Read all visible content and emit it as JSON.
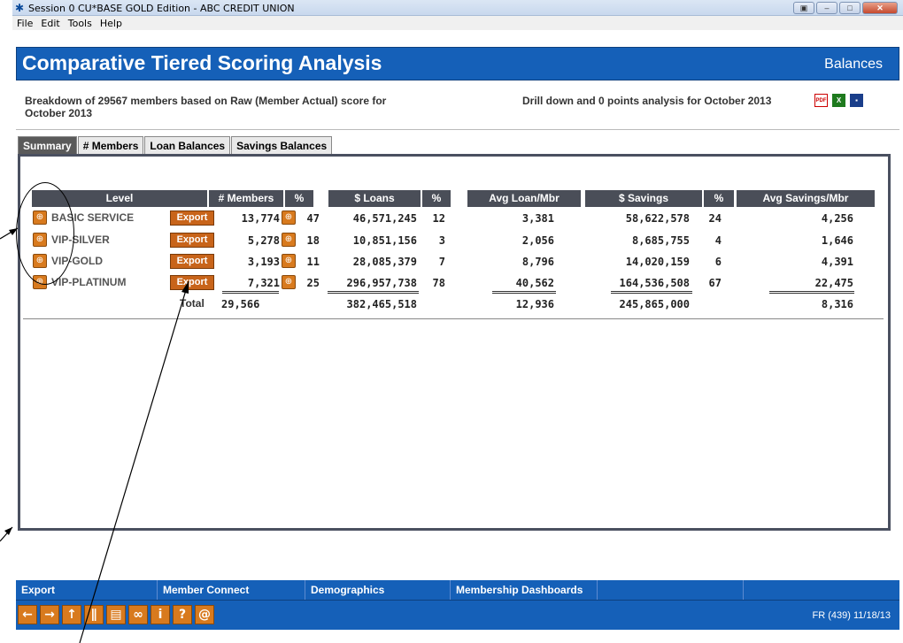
{
  "window": {
    "title": "Session 0 CU*BASE GOLD Edition - ABC CREDIT UNION",
    "menu": [
      "File",
      "Edit",
      "Tools",
      "Help"
    ]
  },
  "header": {
    "title": "Comparative Tiered Scoring Analysis",
    "right_label": "Balances"
  },
  "subheader": {
    "left_line1": "Breakdown of 29567 members based on Raw (Member Actual) score for",
    "left_line2": "October 2013",
    "right": "Drill down and 0 points analysis for October 2013"
  },
  "tabs": [
    "Summary",
    "# Members",
    "Loan Balances",
    "Savings Balances"
  ],
  "table": {
    "columns": [
      "Level",
      "# Members",
      "%",
      "$ Loans",
      "%",
      "Avg Loan/Mbr",
      "$ Savings",
      "%",
      "Avg Savings/Mbr"
    ],
    "export_label": "Export",
    "rows": [
      {
        "level": "BASIC SERVICE",
        "members": "13,774",
        "pct_members": "47",
        "loans": "46,571,245",
        "pct_loans": "12",
        "avg_loan": "3,381",
        "savings": "58,622,578",
        "pct_savings": "24",
        "avg_savings": "4,256"
      },
      {
        "level": "VIP-SILVER",
        "members": "5,278",
        "pct_members": "18",
        "loans": "10,851,156",
        "pct_loans": "3",
        "avg_loan": "2,056",
        "savings": "8,685,755",
        "pct_savings": "4",
        "avg_savings": "1,646"
      },
      {
        "level": "VIP-GOLD",
        "members": "3,193",
        "pct_members": "11",
        "loans": "28,085,379",
        "pct_loans": "7",
        "avg_loan": "8,796",
        "savings": "14,020,159",
        "pct_savings": "6",
        "avg_savings": "4,391"
      },
      {
        "level": "VIP-PLATINUM",
        "members": "7,321",
        "pct_members": "25",
        "loans": "296,957,738",
        "pct_loans": "78",
        "avg_loan": "40,562",
        "savings": "164,536,508",
        "pct_savings": "67",
        "avg_savings": "22,475"
      }
    ],
    "total": {
      "label": "Total",
      "members": "29,566",
      "loans": "382,465,518",
      "avg_loan": "12,936",
      "savings": "245,865,000",
      "avg_savings": "8,316"
    }
  },
  "bottom_menu": [
    "Export",
    "Member Connect",
    "Demographics",
    "Membership Dashboards",
    "",
    ""
  ],
  "toolbar": {
    "status": "FR (439) 11/18/13",
    "icons": [
      "arrow-left-icon",
      "arrow-right-icon",
      "arrow-up-icon",
      "pause-icon",
      "print-icon",
      "link-icon",
      "info-icon",
      "help-icon",
      "at-icon"
    ]
  }
}
